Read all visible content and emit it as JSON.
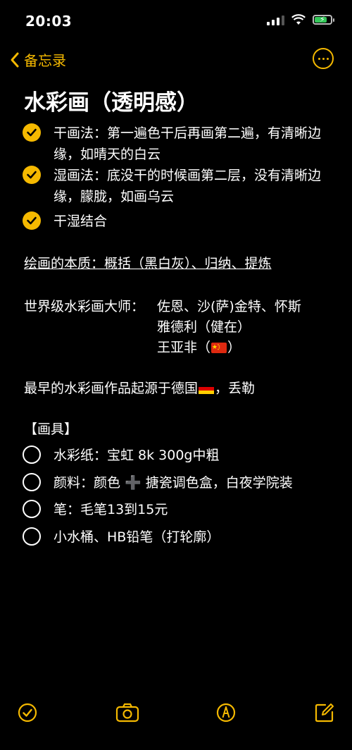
{
  "status": {
    "time": "20:03"
  },
  "nav": {
    "back_label": "备忘录"
  },
  "note": {
    "title": "水彩画（透明感）",
    "checklist_top": [
      {
        "text": "干画法：第一遍色干后再画第二遍，有清晰边缘，如晴天的白云",
        "checked": true
      },
      {
        "text": "湿画法：底没干的时候画第二层，没有清晰边缘，朦胧，如画乌云",
        "checked": true
      },
      {
        "text": "干湿结合",
        "checked": true
      }
    ],
    "essence": "绘画的本质：概括（黑白灰）、归纳、提炼",
    "masters_label": "世界级水彩画大师：",
    "masters_1": "佐恩、沙(萨)金特、怀斯",
    "masters_2": "雅德利（健在）",
    "masters_3a": "王亚非（",
    "masters_3b": "）",
    "origin_a": "最早的水彩画作品起源于德国",
    "origin_b": "，丢勒",
    "tools_header": "【画具】",
    "tools": [
      {
        "text": "水彩纸：宝虹 8k 300g中粗",
        "checked": false
      },
      {
        "text": "颜料：颜色 ➕ 搪瓷调色盒，白夜学院装",
        "checked": false
      },
      {
        "text": "笔：毛笔13到15元",
        "checked": false
      },
      {
        "text": "小水桶、HB铅笔（打轮廓）",
        "checked": false
      }
    ]
  },
  "colors": {
    "accent": "#f5b900",
    "background": "#000000",
    "text": "#ffffff"
  },
  "icons": [
    "checklist-icon",
    "camera-icon",
    "markup-icon",
    "compose-icon"
  ]
}
